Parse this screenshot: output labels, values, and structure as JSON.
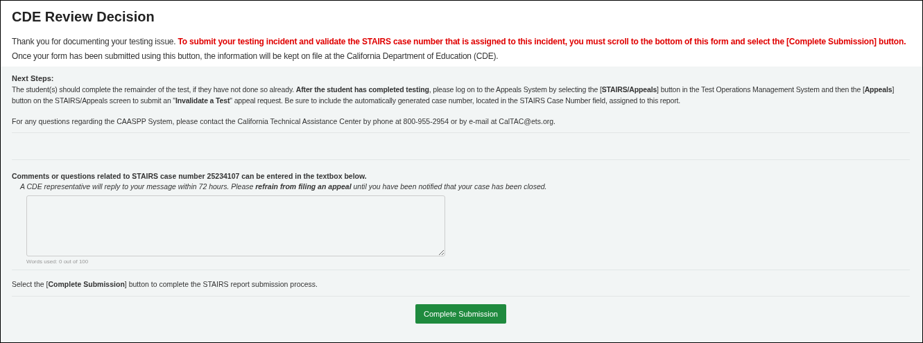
{
  "title": "CDE Review Decision",
  "intro": "Thank you for documenting your testing issue. **To submit your testing incident and validate the STAIRS case number that is assigned to this incident, you must scroll to the bottom of this form and select the [Complete Submission] button.** Once your form has been submitted using this button, the information will be kept on file at the California Department of Education (CDE).",
  "next_steps": {
    "heading": "Next Steps:",
    "text": "The student(s) should complete the remainder of the test, if they have not done so already. **After the student has completed testing**, please log on to the Appeals System by selecting the [**STAIRS/Appeals**] button in the Test Operations Management System and then the [**Appeals**] button on the STAIRS/Appeals screen to submit an \"**Invalidate a Test**\" appeal request. Be sure to include the automatically generated case number, located in the STAIRS Case Number field, assigned to this report.",
    "contact": "For any questions regarding the CAASPP System, please contact the California Technical Assistance Center by phone at 800-955-2954 or by e-mail at CalTAC@ets.org."
  },
  "comments": {
    "heading": "Comments or questions related to STAIRS case number 25234107 can be entered in the textbox below.",
    "note": "A CDE representative will reply to your message within 72 hours. Please **refrain from filing an appeal** until you have been notified that your case has been closed.",
    "word_count": "Words used: 0 out of 100"
  },
  "instruction": "Select the [**Complete Submission**] button to complete the STAIRS report submission process.",
  "submit_button": "Complete Submission"
}
